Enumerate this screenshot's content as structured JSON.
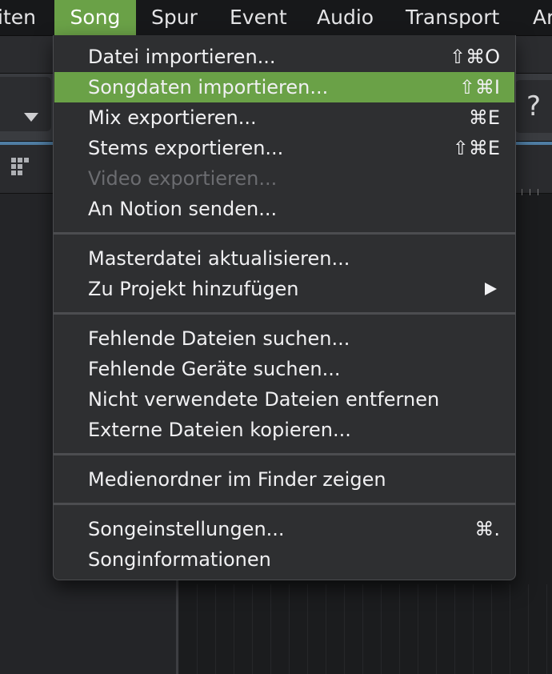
{
  "menubar": {
    "items": [
      "iten",
      "Song",
      "Spur",
      "Event",
      "Audio",
      "Transport",
      "Ar"
    ],
    "active": "Song"
  },
  "toolbar": {
    "help_glyph": "?"
  },
  "song_menu": {
    "items": [
      {
        "label": "Datei importieren...",
        "shortcut": "⇧⌘O"
      },
      {
        "label": "Songdaten importieren...",
        "shortcut": "⇧⌘I",
        "highlighted": true
      },
      {
        "label": "Mix exportieren...",
        "shortcut": "⌘E"
      },
      {
        "label": "Stems exportieren...",
        "shortcut": "⇧⌘E"
      },
      {
        "label": "Video exportieren...",
        "shortcut": "",
        "disabled": true
      },
      {
        "label": "An Notion senden...",
        "shortcut": ""
      },
      {
        "label": "Masterdatei aktualisieren...",
        "shortcut": ""
      },
      {
        "label": "Zu Projekt hinzufügen",
        "shortcut": "",
        "submenu": true
      },
      {
        "label": "Fehlende Dateien suchen...",
        "shortcut": ""
      },
      {
        "label": "Fehlende Geräte suchen...",
        "shortcut": ""
      },
      {
        "label": "Nicht verwendete Dateien entfernen",
        "shortcut": ""
      },
      {
        "label": "Externe Dateien kopieren...",
        "shortcut": ""
      },
      {
        "label": "Medienordner im Finder zeigen",
        "shortcut": ""
      },
      {
        "label": "Songeinstellungen...",
        "shortcut": "⌘."
      },
      {
        "label": "Songinformationen",
        "shortcut": ""
      }
    ]
  },
  "colors": {
    "highlight": "#6aa147",
    "menu_bg": "#2e2f31",
    "menubar_bg": "#17181a",
    "text": "#f0f0f2",
    "disabled_text": "#6b6c70",
    "accent_blue": "#4f7da3"
  }
}
